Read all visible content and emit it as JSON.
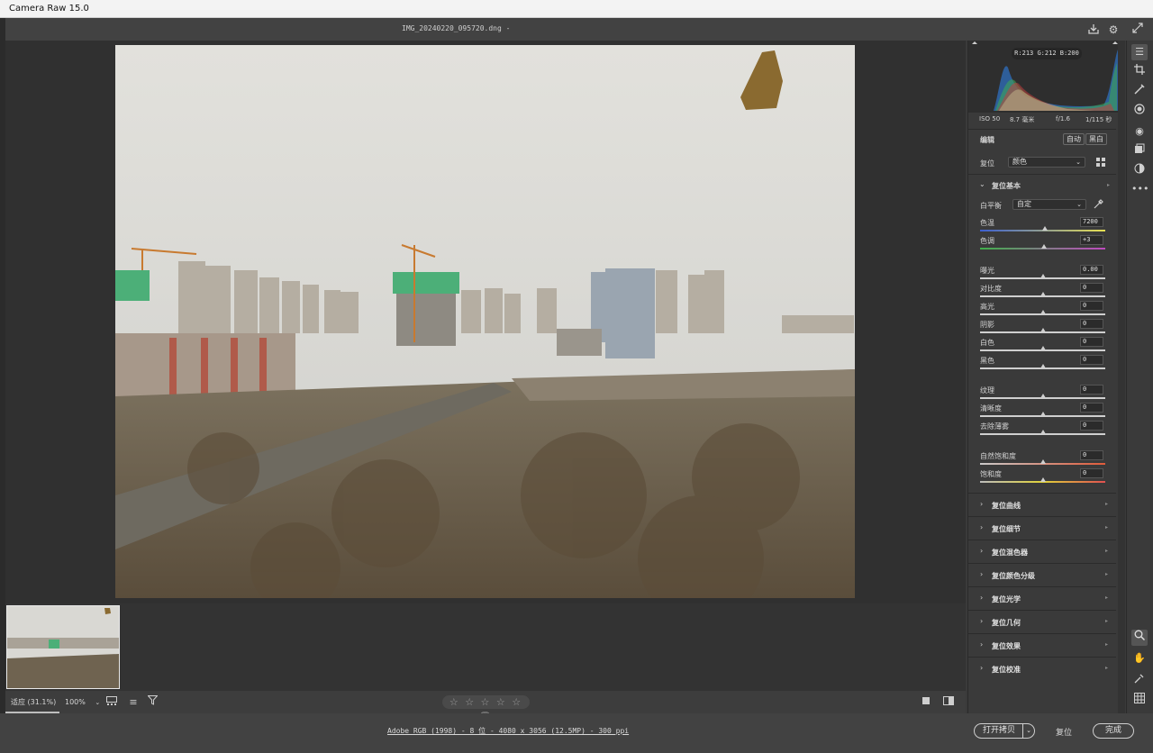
{
  "window": {
    "title": "Camera Raw 15.0"
  },
  "header": {
    "filename": "IMG_20240220_095720.dng -"
  },
  "view": {
    "zoom_fit": "适应 (31.1%)",
    "zoom_100": "100%",
    "stars": "☆ ☆ ☆ ☆ ☆"
  },
  "footer": {
    "file_info": "Adobe RGB (1998) - 8 位 - 4080 x 3056 (12.5MP) - 300 ppi",
    "open_copy": "打开拷贝",
    "reset": "复位",
    "done": "完成"
  },
  "histogram": {
    "rgb_readout": "R:213  G:212  B:200",
    "iso": "ISO 50",
    "focal": "8.7 毫米",
    "aperture": "f/1.6",
    "shutter": "1/115 秒"
  },
  "edit": {
    "title": "编辑",
    "auto": "自动",
    "bw": "黑白",
    "profile_label": "复位",
    "profile_value": "颜色"
  },
  "basic": {
    "title": "复位基本",
    "wb_label": "白平衡",
    "wb_value": "自定",
    "temp": {
      "label": "色温",
      "value": "7200",
      "level": 0.52
    },
    "tint": {
      "label": "色调",
      "value": "+3",
      "level": 0.51
    },
    "exposure": {
      "label": "曝光",
      "value": "0.00",
      "level": 0.5
    },
    "contrast": {
      "label": "对比度",
      "value": "0",
      "level": 0.5
    },
    "highlights": {
      "label": "高光",
      "value": "0",
      "level": 0.5
    },
    "shadows": {
      "label": "阴影",
      "value": "0",
      "level": 0.5
    },
    "whites": {
      "label": "白色",
      "value": "0",
      "level": 0.5
    },
    "blacks": {
      "label": "黑色",
      "value": "0",
      "level": 0.5
    },
    "texture": {
      "label": "纹理",
      "value": "0",
      "level": 0.5
    },
    "clarity": {
      "label": "清晰度",
      "value": "0",
      "level": 0.5
    },
    "dehaze": {
      "label": "去除薄雾",
      "value": "0",
      "level": 0.5
    },
    "vibrance": {
      "label": "自然饱和度",
      "value": "0",
      "level": 0.5
    },
    "saturation": {
      "label": "饱和度",
      "value": "0",
      "level": 0.5
    }
  },
  "sections": [
    {
      "name": "复位曲线"
    },
    {
      "name": "复位细节"
    },
    {
      "name": "复位混色器"
    },
    {
      "name": "复位颜色分级"
    },
    {
      "name": "复位光学"
    },
    {
      "name": "复位几何"
    },
    {
      "name": "复位效果"
    },
    {
      "name": "复位校准"
    }
  ],
  "colors": {
    "panel_bg": "#3a3a3a",
    "canvas_bg": "#303030",
    "accent_border": "#e9e9e9"
  }
}
